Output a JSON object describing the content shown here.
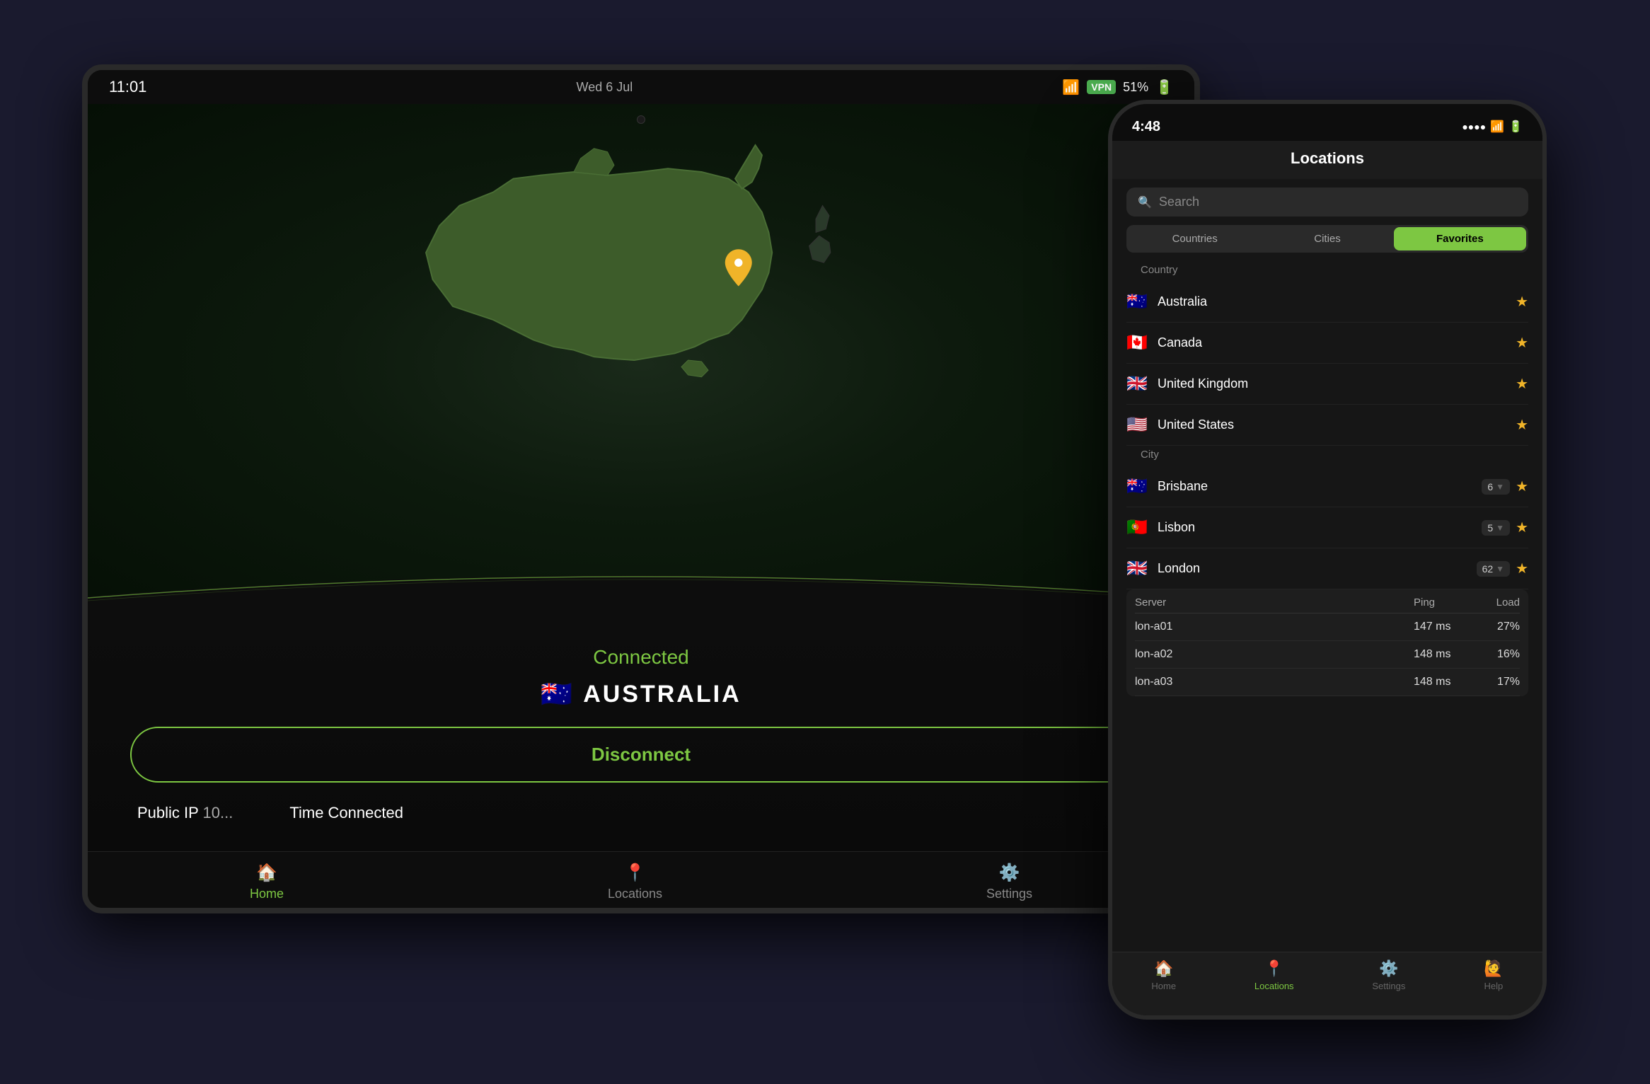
{
  "tablet": {
    "time": "11:01",
    "date": "Wed 6 Jul",
    "vpn_badge": "VPN",
    "battery": "51%",
    "status": "Connected",
    "country": "AUSTRALIA",
    "disconnect_btn": "Disconnect",
    "public_ip_label": "Public IP",
    "public_ip_value": "10...",
    "time_connected_label": "Time Connected",
    "time_connected_value": ""
  },
  "tablet_nav": [
    {
      "label": "Home",
      "icon": "🏠",
      "active": true
    },
    {
      "label": "Locations",
      "icon": "📍",
      "active": false
    },
    {
      "label": "Settings",
      "icon": "⚙️",
      "active": false
    }
  ],
  "phone": {
    "time": "4:48",
    "signal_icon": "...",
    "wifi_icon": "wifi",
    "battery_icon": "battery",
    "title": "Locations",
    "search_placeholder": "Search"
  },
  "phone_tabs": [
    {
      "label": "Countries",
      "active": false
    },
    {
      "label": "Cities",
      "active": false
    },
    {
      "label": "Favorites",
      "active": true
    }
  ],
  "section_country_label": "Country",
  "section_city_label": "City",
  "countries": [
    {
      "name": "Australia",
      "flag": "🇦🇺",
      "starred": true
    },
    {
      "name": "Canada",
      "flag": "🇨🇦",
      "starred": true
    },
    {
      "name": "United Kingdom",
      "flag": "🇬🇧",
      "starred": true
    },
    {
      "name": "United States",
      "flag": "🇺🇸",
      "starred": true
    }
  ],
  "cities": [
    {
      "name": "Brisbane",
      "flag": "🇦🇺",
      "count": 6,
      "starred": true,
      "expanded": false
    },
    {
      "name": "Lisbon",
      "flag": "🇵🇹",
      "count": 5,
      "starred": true,
      "expanded": false
    },
    {
      "name": "London",
      "flag": "🇬🇧",
      "count": 62,
      "starred": true,
      "expanded": true
    }
  ],
  "london_servers": {
    "header": {
      "server": "Server",
      "ping": "Ping",
      "load": "Load"
    },
    "rows": [
      {
        "name": "lon-a01",
        "ping": "147 ms",
        "load": "27%"
      },
      {
        "name": "lon-a02",
        "ping": "148 ms",
        "load": "16%"
      },
      {
        "name": "lon-a03",
        "ping": "148 ms",
        "load": "17%"
      }
    ]
  },
  "phone_nav": [
    {
      "label": "Home",
      "icon": "🏠",
      "active": false
    },
    {
      "label": "Locations",
      "icon": "📍",
      "active": true
    },
    {
      "label": "Settings",
      "icon": "⚙️",
      "active": false
    },
    {
      "label": "Help",
      "icon": "🙋",
      "active": false
    }
  ],
  "colors": {
    "accent": "#7dc742",
    "star": "#f0b429",
    "bg_dark": "#0d0d0d",
    "text_muted": "#888888"
  }
}
